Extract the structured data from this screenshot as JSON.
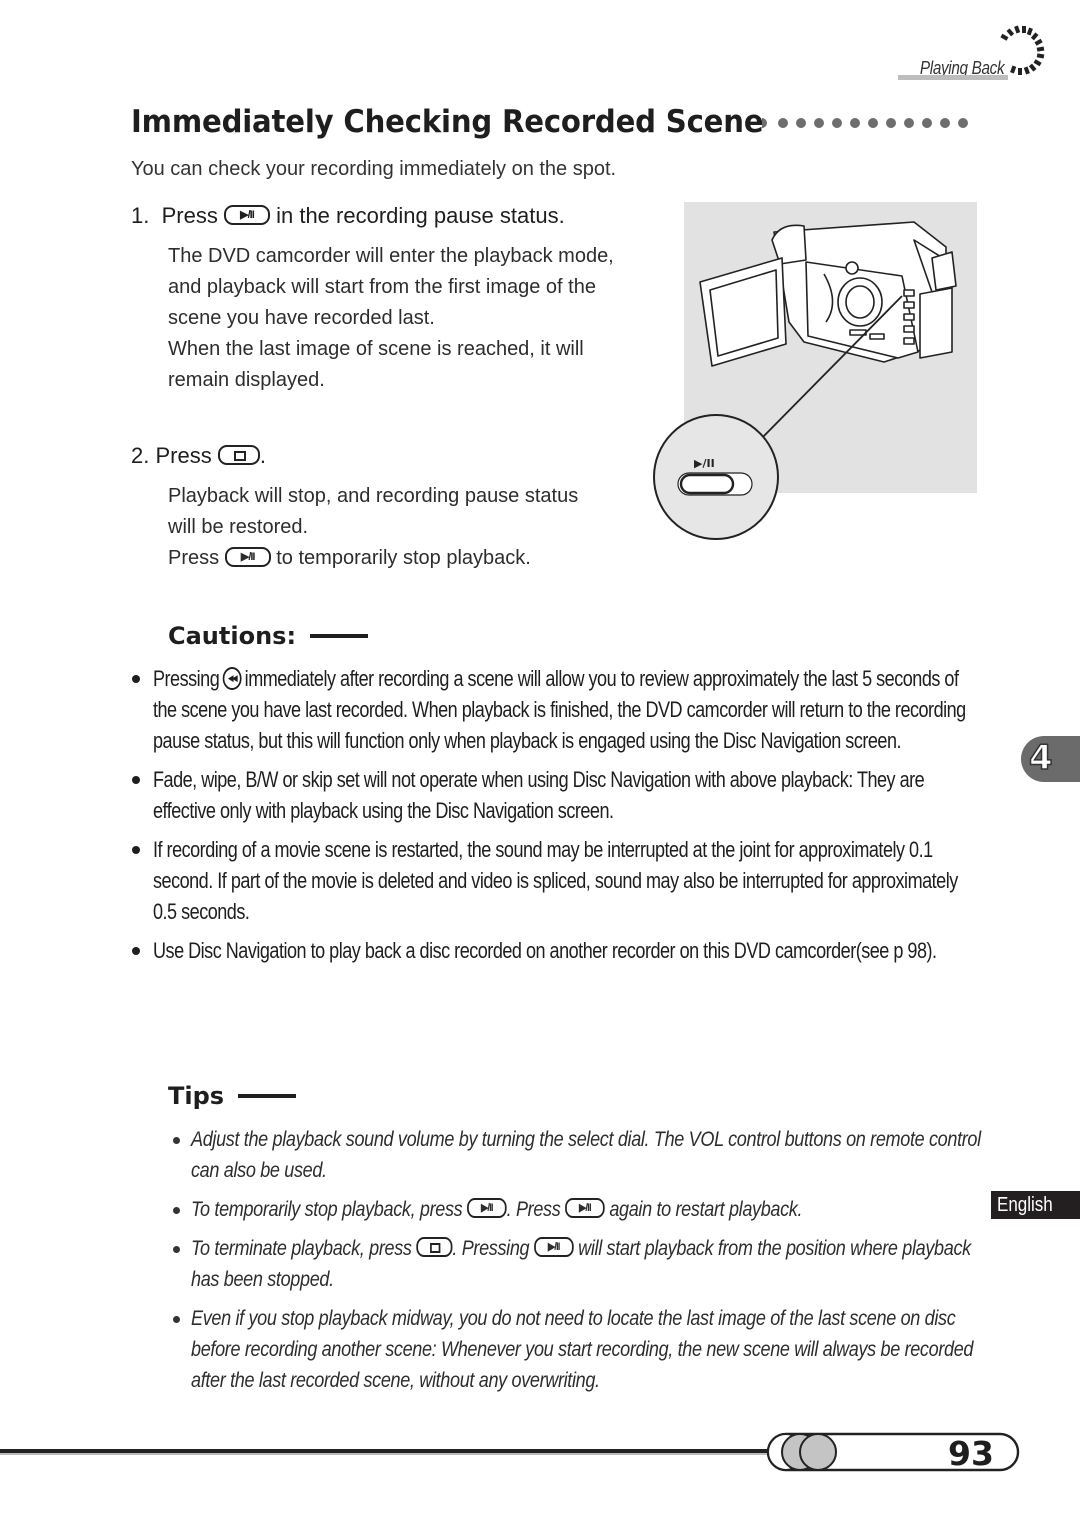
{
  "header": {
    "section_label": "Playing Back"
  },
  "title": "Immediately Checking Recorded Scene",
  "intro": "You can check your recording immediately on the spot.",
  "step1": {
    "number": "1.",
    "head_pre": "Press",
    "head_icon": "play-pause-button-icon",
    "head_post": "in the recording pause status.",
    "body": [
      "The DVD camcorder will enter the playback mode,",
      "and playback will start from the first image of the",
      "scene you have recorded last.",
      "When the last image of scene is reached, it will",
      "remain displayed."
    ]
  },
  "step2": {
    "number": "2.",
    "head_pre": "Press",
    "head_icon": "stop-button-icon",
    "head_post": ".",
    "body_line1": "Playback will stop, and recording pause status",
    "body_line2": "will be restored.",
    "body_line3_pre": "Press",
    "body_line3_icon": "play-pause-button-icon",
    "body_line3_post": "to temporarily stop playback."
  },
  "illustration": {
    "description": "DVD camcorder with open LCD screen, callout to play/pause button",
    "callout_label": "▶/II"
  },
  "icons": {
    "play_pause_glyph": "▶/II",
    "rewind_glyph": "◀◀"
  },
  "cautions": {
    "heading": "Cautions:",
    "items": [
      {
        "pre": "Pressing",
        "icon": "rewind-button-icon",
        "post": "immediately after recording a scene will allow you to review approximately the last 5 seconds of the scene you have last recorded. When playback is finished, the DVD camcorder will return to the recording pause status, but this will function only when playback is engaged using the Disc Navigation screen."
      },
      {
        "text": "Fade, wipe, B/W or skip set will not operate when using Disc Navigation with above playback: They are effective only with playback using the Disc Navigation screen."
      },
      {
        "text": "If recording of a movie scene is restarted, the sound may be interrupted at the joint for approximately 0.1 second. If part of the movie is deleted and video is spliced, sound may also be interrupted for approximately 0.5 seconds."
      },
      {
        "text": "Use Disc Navigation to play back a disc recorded on another recorder on this DVD camcorder(see p 98)."
      }
    ]
  },
  "tips": {
    "heading": "Tips",
    "items": [
      {
        "text": "Adjust the playback sound volume by turning the select dial. The VOL control buttons on remote control can also be used."
      },
      {
        "a": "To temporarily stop playback, press",
        "b": ". Press",
        "c": "again to restart playback."
      },
      {
        "a": "To terminate playback, press",
        "b": ". Pressing",
        "c": "will start playback from the position where playback has been stopped."
      },
      {
        "text": "Even if you stop playback midway, you do not need to locate the last image of the last scene on disc before recording another scene: Whenever you start recording, the new scene will always be recorded after the last recorded scene, without any overwriting."
      }
    ]
  },
  "side_tabs": {
    "chapter": "4",
    "language": "English"
  },
  "footer": {
    "page_number": "93"
  }
}
